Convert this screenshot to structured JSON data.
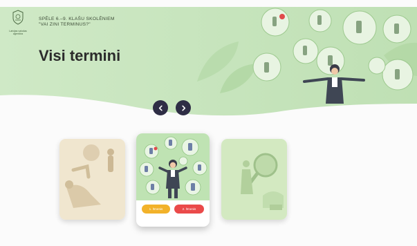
{
  "logo": {
    "lines": [
      "Latvijas valodas",
      "aģentūra"
    ]
  },
  "header": {
    "game_title_line1": "SPĒLE 6.–9. KLAŠU SKOLĒNIEM",
    "game_title_line2": "\"VAI ZINI TERMINUS?\"",
    "page_title": "Visi termini"
  },
  "carousel": {
    "prev_icon": "chevron-left-icon",
    "next_icon": "chevron-right-icon",
    "active_card": {
      "buttons": [
        {
          "label": "1. līmenis",
          "color": "#f2b22a"
        },
        {
          "label": "2. līmenis",
          "color": "#ea4a4a"
        }
      ]
    }
  },
  "colors": {
    "hero_green": "#c9e6bf",
    "nav_dark": "#2e2d45",
    "accent_yellow": "#f2b22a",
    "accent_red": "#ea4a4a"
  }
}
